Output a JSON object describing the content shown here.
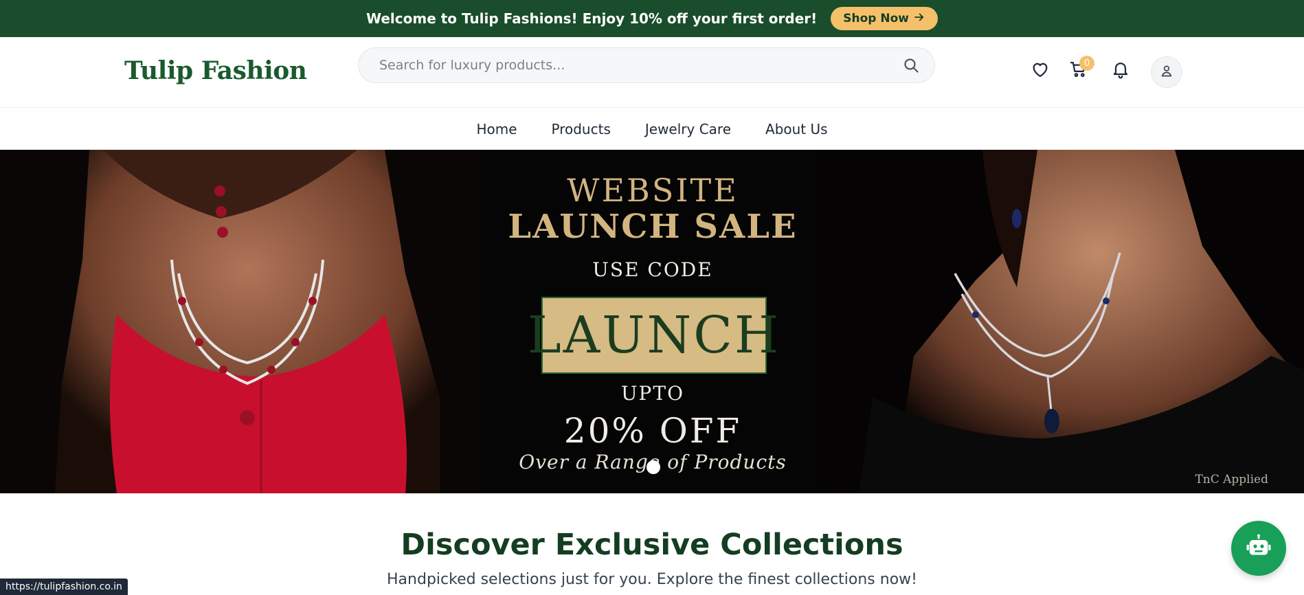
{
  "promo_bar": {
    "message": "Welcome to Tulip Fashions! Enjoy 10% off your first order!",
    "cta_label": "Shop Now"
  },
  "header": {
    "logo": "Tulip Fashion",
    "search_placeholder": "Search for luxury products...",
    "cart_count": "0",
    "icons": [
      "heart-icon",
      "cart-icon",
      "bell-icon",
      "user-icon",
      "search-icon"
    ]
  },
  "nav": {
    "items": [
      {
        "label": "Home"
      },
      {
        "label": "Products"
      },
      {
        "label": "Jewelry Care"
      },
      {
        "label": "About Us"
      }
    ]
  },
  "hero": {
    "line1": "WEBSITE",
    "line2": "LAUNCH SALE",
    "use_code": "USE CODE",
    "code": "LAUNCH",
    "upto": "UPTO",
    "discount": "20% OFF",
    "range": "Over a Range of Products",
    "tnc": "TnC Applied"
  },
  "section": {
    "title": "Discover Exclusive Collections",
    "subtitle": "Handpicked selections just for you. Explore the finest collections now!"
  },
  "status_bar": {
    "url": "https://tulipfashion.co.in"
  },
  "colors": {
    "brand_green": "#1a4d2b",
    "accent_gold": "#f5c06a",
    "hero_gold": "#d2b47f",
    "chat_green": "#18a058"
  }
}
